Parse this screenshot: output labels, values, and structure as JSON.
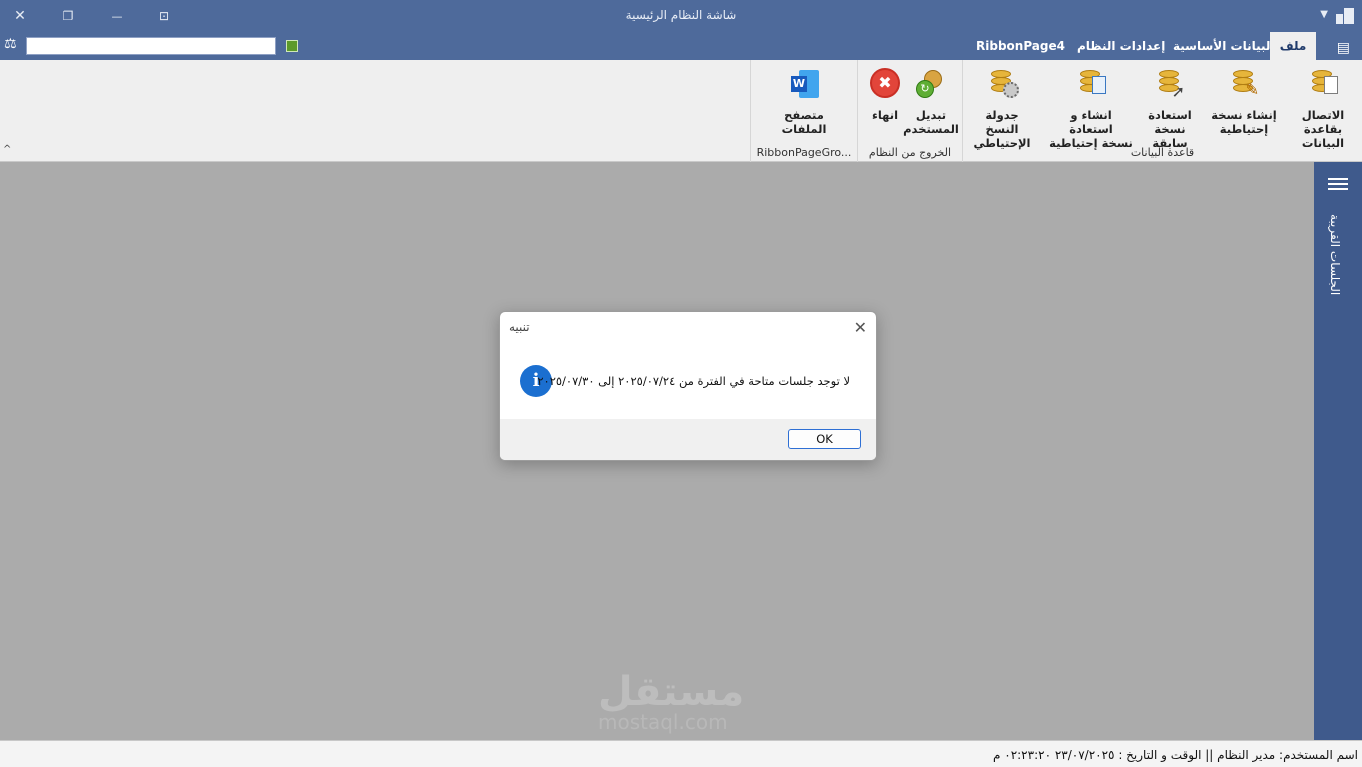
{
  "window": {
    "title": "شاشة النظام الرئيسية",
    "close_glyph": "✕",
    "restore_glyph": "❐",
    "minimize_glyph": "—",
    "extra_glyph": "⊡"
  },
  "tabs": [
    {
      "label": "ملف"
    },
    {
      "label": "البيانات الأساسية"
    },
    {
      "label": "إعدادات النظام"
    },
    {
      "label": "RibbonPage4"
    }
  ],
  "ribbon": {
    "groups": [
      {
        "label": "قاعدة البيانات",
        "buttons": [
          {
            "label1": "الاتصال بقاعدة",
            "label2": "البيانات"
          },
          {
            "label1": "إنشاء نسخة",
            "label2": "إحتياطية"
          },
          {
            "label1": "استعادة",
            "label2": "نسخة سابقة"
          },
          {
            "label1": "انشاء و استعادة",
            "label2": "نسخة إحتياطية"
          },
          {
            "label1": "جدولة النسخ",
            "label2": "الإحتياطي"
          }
        ]
      },
      {
        "label": "الخروج من النظام",
        "buttons": [
          {
            "label1": "تبديل",
            "label2": "المستخدم"
          },
          {
            "label1": "انهاء",
            "label2": ""
          }
        ]
      },
      {
        "label": "RibbonPageGro...",
        "buttons": [
          {
            "label1": "متصفح",
            "label2": "الملفات"
          }
        ]
      }
    ]
  },
  "navpane": {
    "label": "الجلسات القريبة"
  },
  "dialog": {
    "title": "تنبيه",
    "close_glyph": "✕",
    "icon_glyph": "i",
    "message": "لا توجد جلسات متاحة في الفترة من ٢٠٢٥/٠٧/٢٤ إلى ٢٠٢٥/٠٧/٣٠",
    "ok_label": "OK"
  },
  "watermark": {
    "main": "مستقل",
    "sub": "mostaql.com"
  },
  "statusbar": {
    "text": "اسم المستخدم:  مدير  النظام  ||  الوقت و التاريخ :  ٢٣/٠٧/٢٠٢٥  ٠٢:٢٣:٢٠ م"
  },
  "colors": {
    "title_bar": "#4e6a9b",
    "nav_pane": "#3f5a8c",
    "workspace": "#ababab",
    "ribbon": "#efefef",
    "info_blue": "#1b6fd0",
    "close_red": "#e2453a"
  }
}
